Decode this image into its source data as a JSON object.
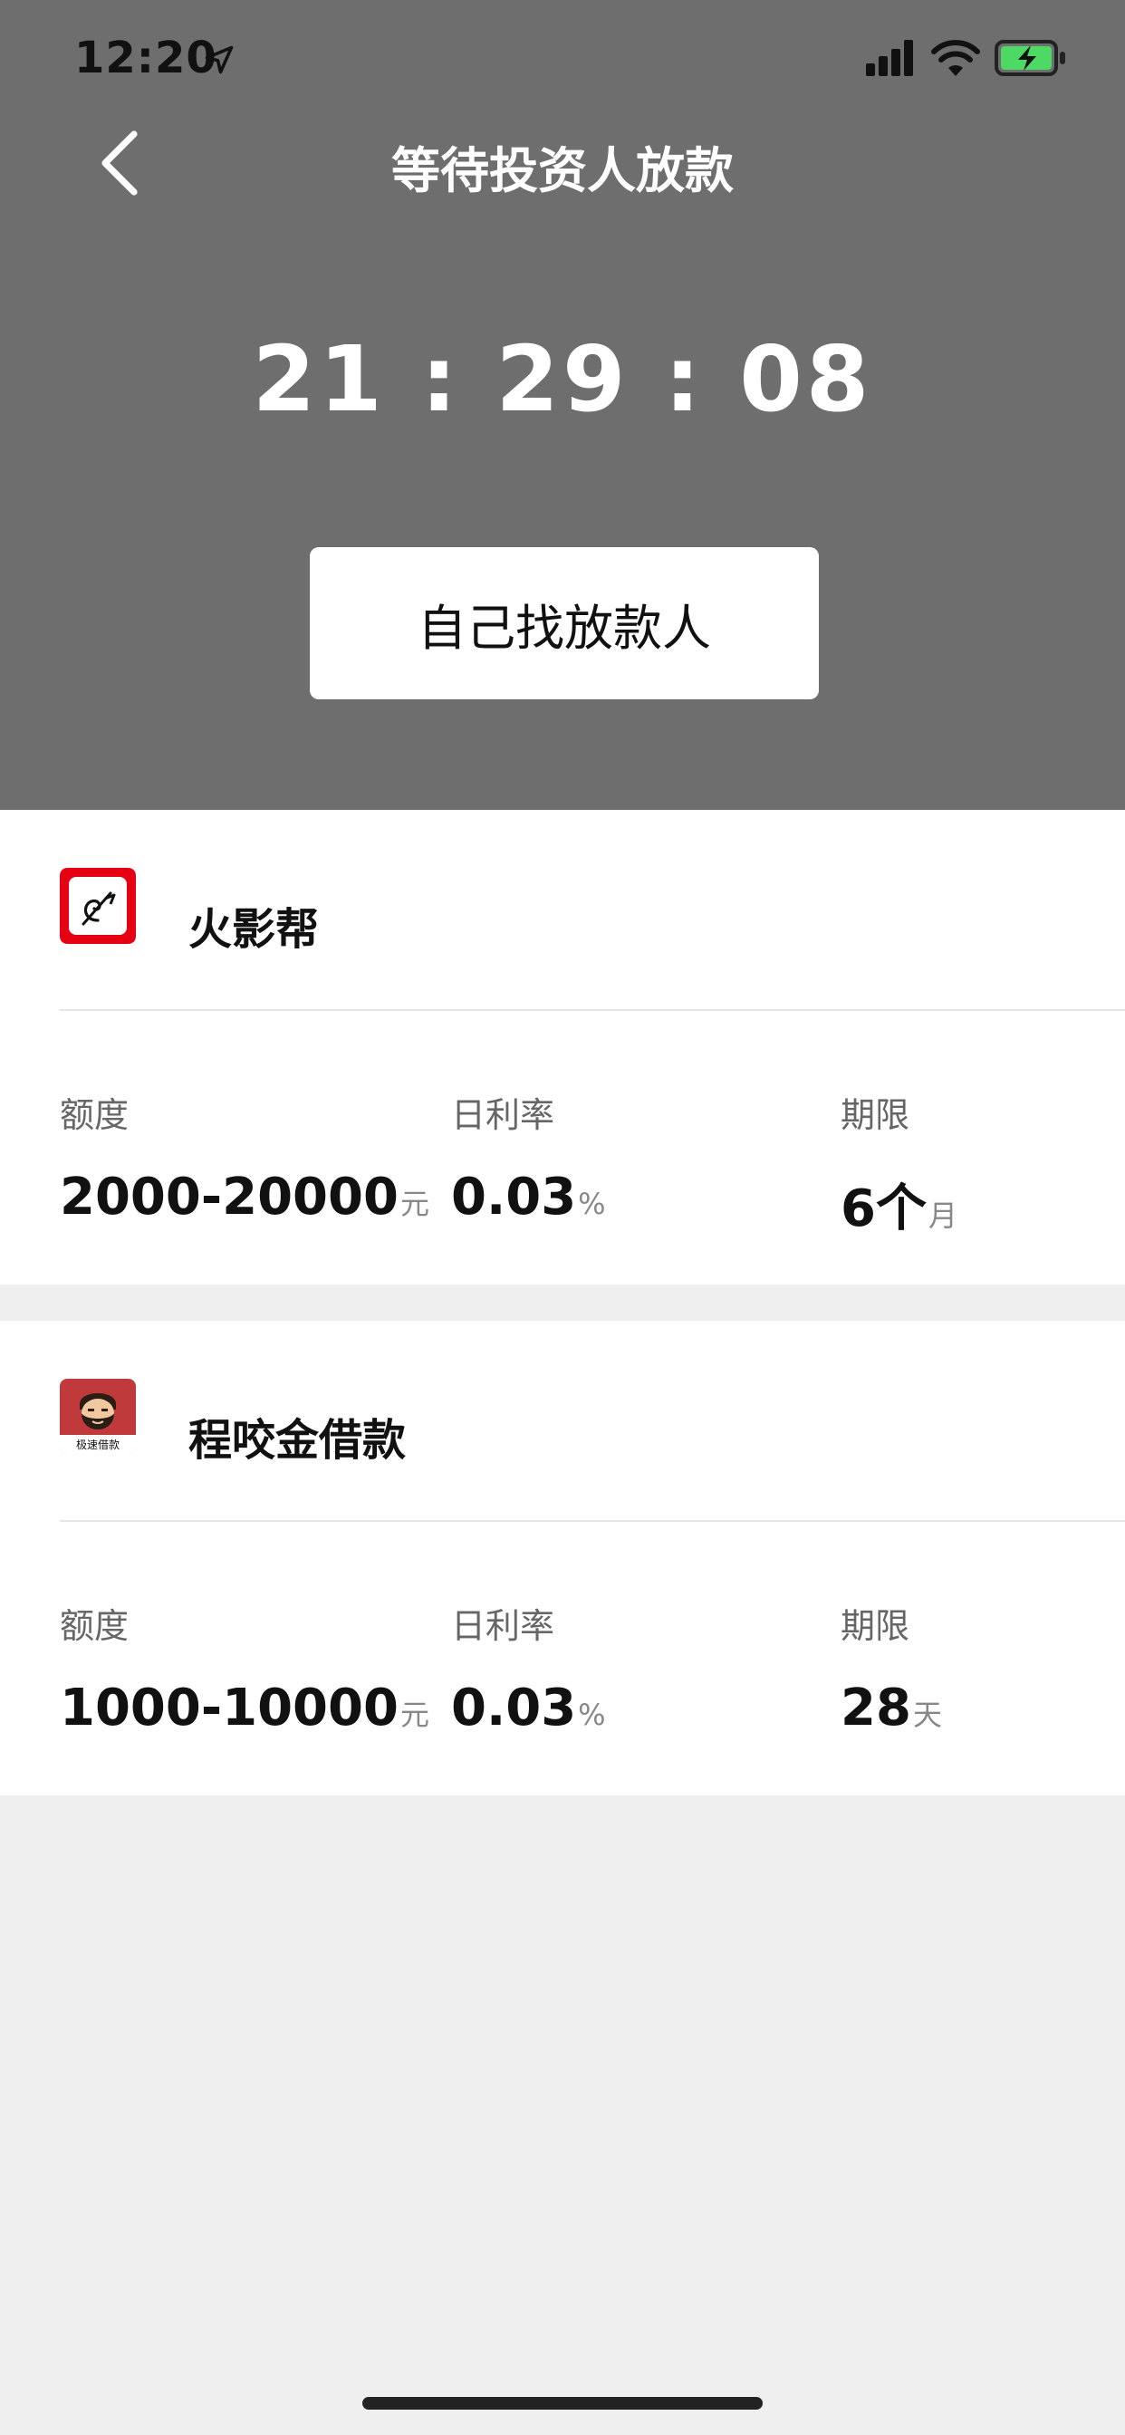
{
  "status_bar": {
    "time": "12:20",
    "icons": [
      "location-arrow-icon",
      "signal-icon",
      "wifi-icon",
      "battery-charging-icon"
    ],
    "battery_color": "#4cd964"
  },
  "nav": {
    "title": "等待投资人放款",
    "back_icon": "chevron-left-icon"
  },
  "countdown": "21 : 29 : 08",
  "find_button_label": "自己找放款人",
  "colors": {
    "header_bg": "#6e6e6e",
    "page_bg": "#efefef",
    "card_bg": "#ffffff",
    "logo1_bg": "#e50012"
  },
  "lenders": [
    {
      "name": "火影帮",
      "fields": [
        {
          "label": "额度",
          "value": "2000-20000",
          "unit": "元"
        },
        {
          "label": "日利率",
          "value": "0.03",
          "unit": "%"
        },
        {
          "label": "期限",
          "value": "6个",
          "unit": "月"
        }
      ]
    },
    {
      "name": "程咬金借款",
      "logo_text": "极速借款",
      "fields": [
        {
          "label": "额度",
          "value": "1000-10000",
          "unit": "元"
        },
        {
          "label": "日利率",
          "value": "0.03",
          "unit": "%"
        },
        {
          "label": "期限",
          "value": "28",
          "unit": "天"
        }
      ]
    }
  ]
}
